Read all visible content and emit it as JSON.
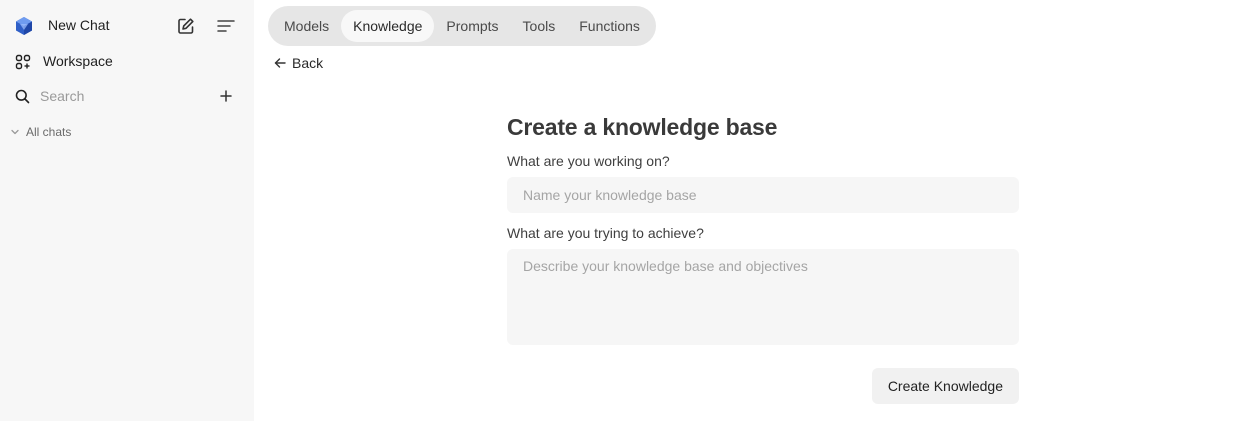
{
  "sidebar": {
    "new_chat_label": "New Chat",
    "workspace_label": "Workspace",
    "search_placeholder": "Search",
    "all_chats_label": "All chats"
  },
  "tabs": [
    {
      "label": "Models",
      "active": false
    },
    {
      "label": "Knowledge",
      "active": true
    },
    {
      "label": "Prompts",
      "active": false
    },
    {
      "label": "Tools",
      "active": false
    },
    {
      "label": "Functions",
      "active": false
    }
  ],
  "back_label": "Back",
  "form": {
    "title": "Create a knowledge base",
    "name_label": "What are you working on?",
    "name_placeholder": "Name your knowledge base",
    "description_label": "What are you trying to achieve?",
    "description_placeholder": "Describe your knowledge base and objectives",
    "submit_label": "Create Knowledge"
  },
  "colors": {
    "sidebar_bg": "#f7f7f7",
    "tabs_bg": "#e6e6e6",
    "field_bg": "#f6f6f6",
    "logo_blue": "#3b6fd8"
  }
}
